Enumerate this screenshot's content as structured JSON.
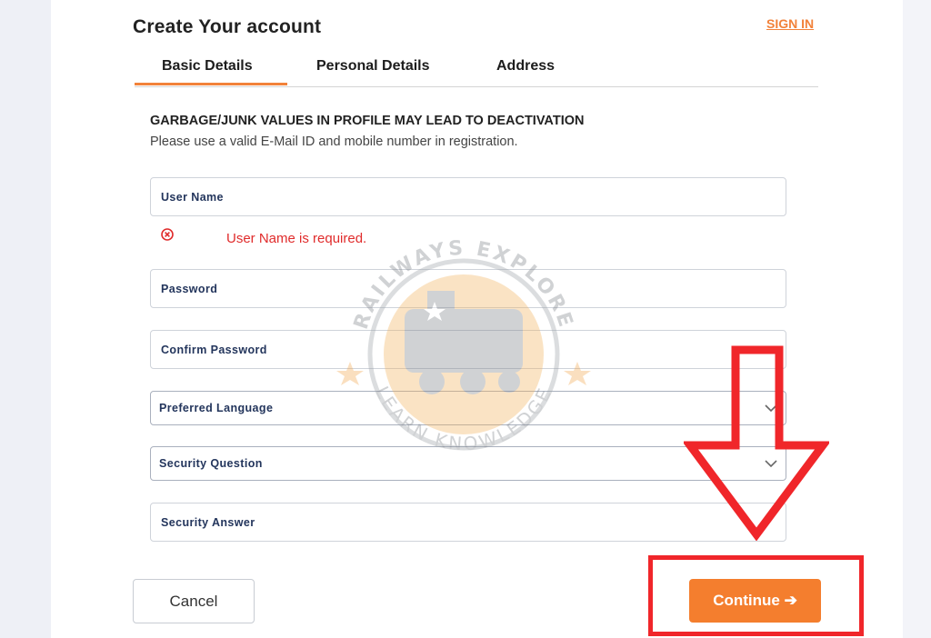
{
  "header": {
    "title": "Create Your account",
    "signin_label": "SIGN IN"
  },
  "tabs": [
    {
      "label": "Basic Details",
      "active": true
    },
    {
      "label": "Personal Details",
      "active": false
    },
    {
      "label": "Address",
      "active": false
    }
  ],
  "notice": {
    "title": "GARBAGE/JUNK VALUES IN PROFILE MAY LEAD TO DEACTIVATION",
    "body": "Please use a valid E-Mail ID and mobile number in registration."
  },
  "form": {
    "username": {
      "label": "User Name",
      "error": "User Name is required."
    },
    "password": {
      "label": "Password"
    },
    "confirm_password": {
      "label": "Confirm Password"
    },
    "preferred_language": {
      "label": "Preferred Language"
    },
    "security_question": {
      "label": "Security Question"
    },
    "security_answer": {
      "label": "Security Answer"
    }
  },
  "actions": {
    "cancel_label": "Cancel",
    "continue_label": "Continue ➔"
  },
  "watermark": {
    "top_text": "RAILWAYS EXPLORE",
    "bottom_text": "LEARN KNOWLEDGE"
  },
  "colors": {
    "accent": "#f47e2e",
    "error": "#e02b2b",
    "annotation": "#f0262a"
  }
}
